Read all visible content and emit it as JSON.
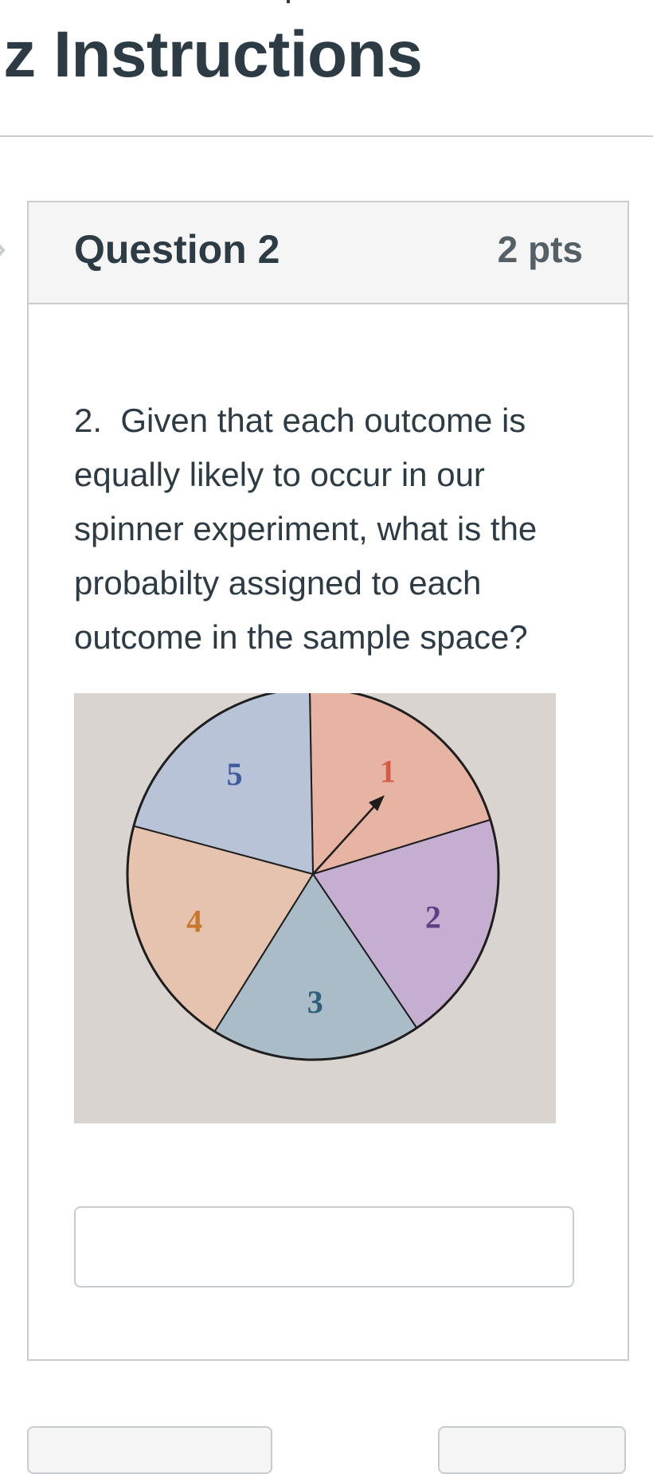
{
  "page": {
    "title": "iz Instructions"
  },
  "question": {
    "name": "Question 2",
    "points": "2 pts",
    "text": "2.  Given that each outcome is\nequally likely to occur in our\nspinner experiment, what is the\nprobabilty assigned to each\noutcome in the sample space?",
    "answer_value": "",
    "answer_placeholder": ""
  },
  "spinner": {
    "sectors": [
      {
        "label": "1",
        "fill": "#e7b3a2",
        "label_color": "#d45a45"
      },
      {
        "label": "2",
        "fill": "#c5aed0",
        "label_color": "#5e3f86"
      },
      {
        "label": "3",
        "fill": "#a9bcc8",
        "label_color": "#2f5e7a"
      },
      {
        "label": "4",
        "fill": "#e5c3ae",
        "label_color": "#c9772e"
      },
      {
        "label": "5",
        "fill": "#b9c3d8",
        "label_color": "#3f5a9e"
      }
    ]
  },
  "colors": {
    "text": "#2d3b45",
    "border": "#c7cdd1",
    "header_bg": "#f5f5f5"
  }
}
